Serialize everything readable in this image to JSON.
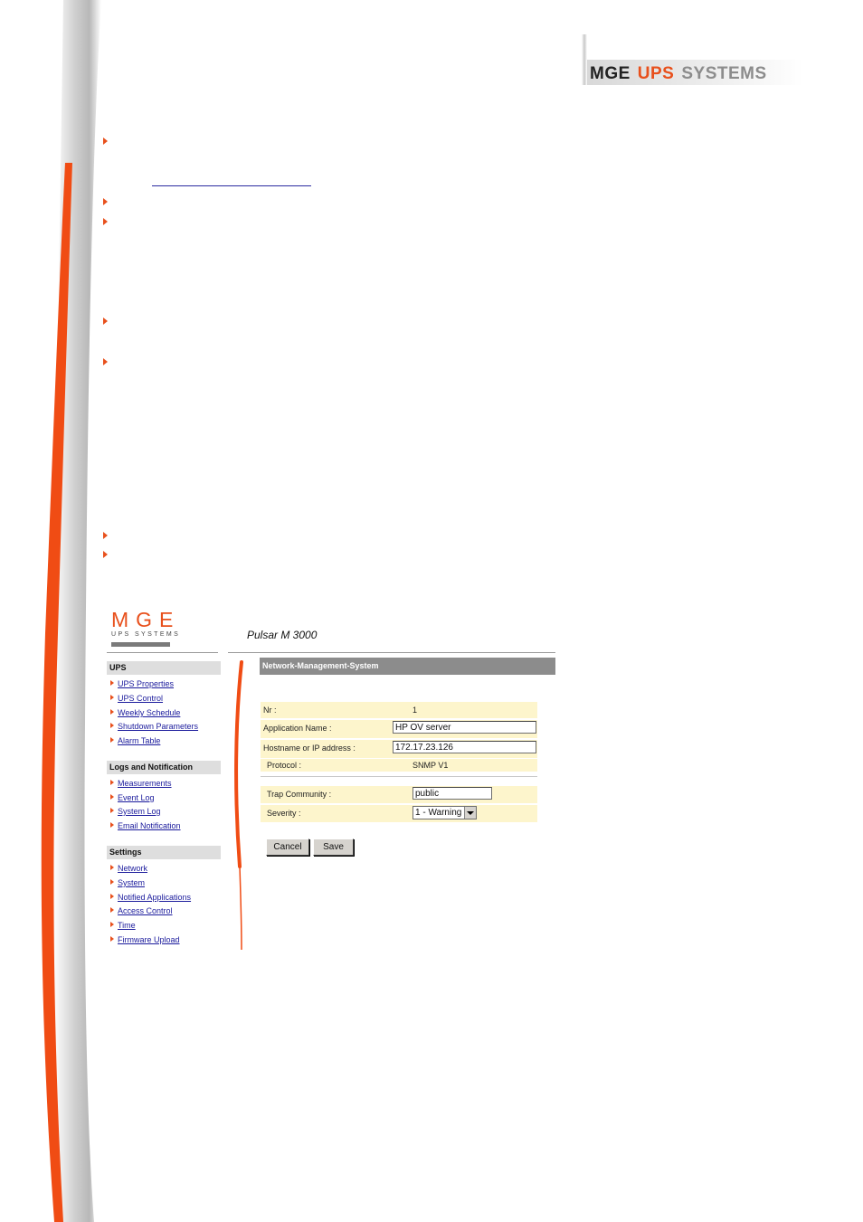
{
  "header_logo": {
    "word1": "MGE",
    "word2": "UPS",
    "word3": "SYSTEMS"
  },
  "screenshot": {
    "logo": {
      "big": "MGE",
      "small": "UPS SYSTEMS"
    },
    "device_title": "Pulsar M 3000",
    "sidebar": {
      "sections": [
        {
          "title": "UPS",
          "items": [
            "UPS Properties",
            "UPS Control",
            "Weekly Schedule",
            "Shutdown Parameters",
            "Alarm Table"
          ]
        },
        {
          "title": "Logs and Notification",
          "items": [
            "Measurements",
            "Event Log",
            "System Log",
            "Email Notification"
          ]
        },
        {
          "title": "Settings",
          "items": [
            "Network",
            "System",
            "Notified Applications",
            "Access Control",
            "Time",
            "Firmware Upload"
          ]
        }
      ]
    },
    "panel": {
      "title": "Network-Management-System",
      "nr_label": "Nr :",
      "nr_value": "1",
      "app_name_label": "Application Name :",
      "app_name_value": "HP OV server",
      "host_label": "Hostname or IP address :",
      "host_value": "172.17.23.126",
      "protocol_label": "Protocol :",
      "protocol_value": "SNMP V1",
      "trap_label": "Trap Community :",
      "trap_value": "public",
      "severity_label": "Severity :",
      "severity_value": "1 - Warning",
      "cancel_label": "Cancel",
      "save_label": "Save"
    }
  },
  "colors": {
    "brand_orange": "#e8501c",
    "link_blue": "#1a1a9c",
    "form_bg": "#fdf5cc"
  }
}
